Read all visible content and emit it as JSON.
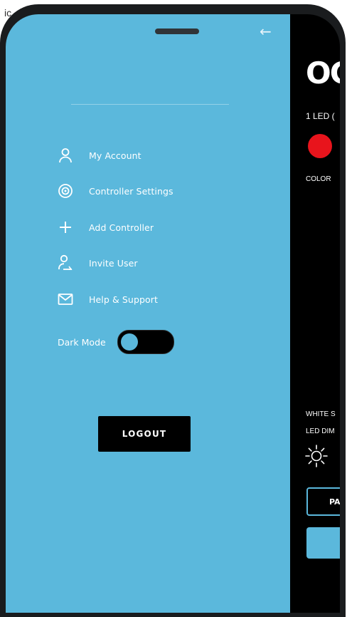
{
  "caption": "ic",
  "drawer": {
    "back_icon": "arrow-left-icon",
    "menu": [
      {
        "label": "My Account",
        "icon": "user-icon"
      },
      {
        "label": "Controller Settings",
        "icon": "target-icon"
      },
      {
        "label": "Add Controller",
        "icon": "plus-icon"
      },
      {
        "label": "Invite User",
        "icon": "user-add-icon"
      },
      {
        "label": "Help & Support",
        "icon": "mail-icon"
      }
    ],
    "dark_mode": {
      "label": "Dark Mode",
      "on": false
    },
    "logout_label": "LOGOUT",
    "accent_color": "#5bb8dc"
  },
  "background": {
    "title_fragment": "OC",
    "led_label": "1 LED (",
    "color_label": "COLOR",
    "color_swatch": "#e8141c",
    "white_label": "WHITE S",
    "dim_label": "LED DIM",
    "button_label": "PA"
  }
}
